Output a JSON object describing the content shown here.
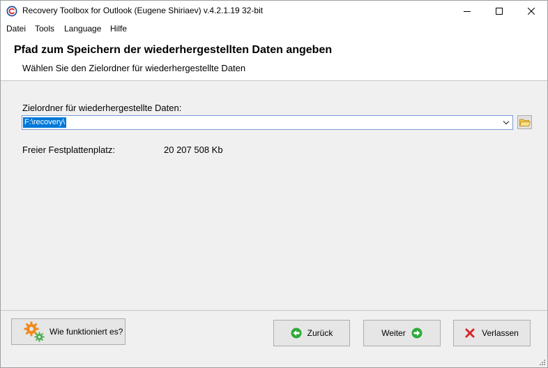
{
  "window": {
    "title": "Recovery Toolbox for Outlook (Eugene Shiriaev) v.4.2.1.19 32-bit"
  },
  "menu": {
    "items": [
      "Datei",
      "Tools",
      "Language",
      "Hilfe"
    ]
  },
  "header": {
    "title": "Pfad zum Speichern der wiederhergestellten Daten angeben",
    "subtitle": "Wählen Sie den Zielordner für wiederhergestellte Daten"
  },
  "destination": {
    "label": "Zielordner für wiederhergestellte Daten:",
    "value": "F:\\recovery\\"
  },
  "disk_space": {
    "label": "Freier Festplattenplatz:",
    "value": "20 207 508 Kb"
  },
  "footer": {
    "help_label": "Wie funktioniert es?",
    "back_label": "Zurück",
    "next_label": "Weiter",
    "exit_label": "Verlassen"
  },
  "icons": {
    "app": "recovery-toolbox-logo",
    "help": "gears",
    "back": "arrow-left-circle",
    "next": "arrow-right-circle",
    "exit": "red-x",
    "folder": "folder-open"
  },
  "colors": {
    "selection": "#0078d7",
    "green_arrow": "#2eaa3a",
    "red_x": "#d7262a",
    "orange_gear": "#f08a1c",
    "green_gear": "#4caf50"
  }
}
